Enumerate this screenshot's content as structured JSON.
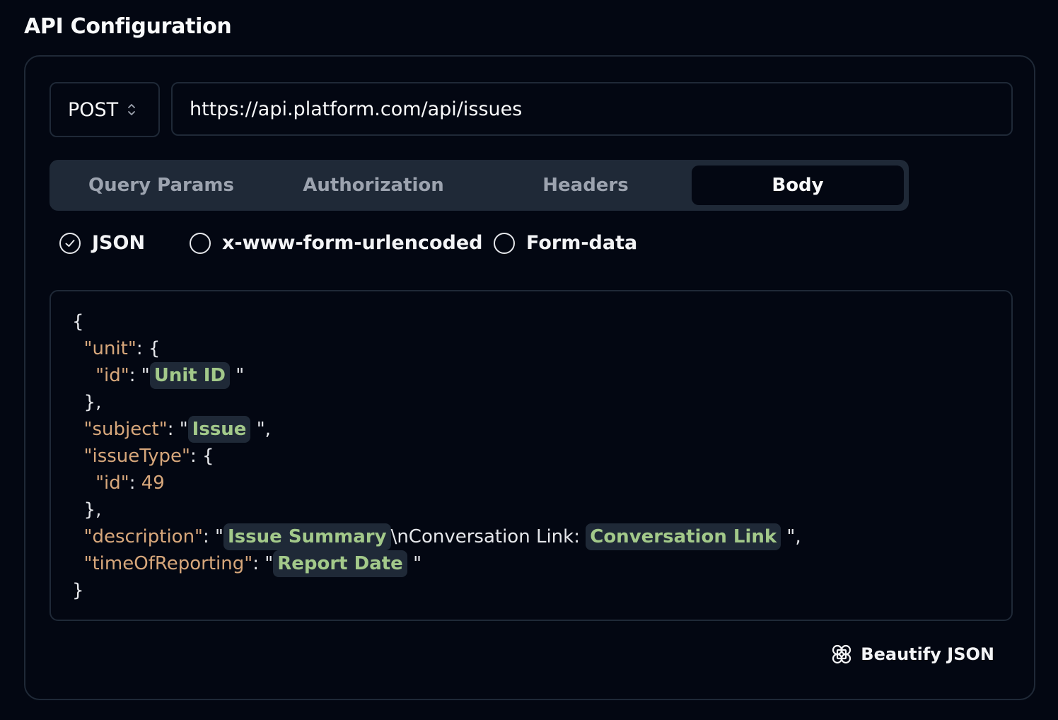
{
  "page": {
    "title": "API Configuration"
  },
  "request": {
    "method": "POST",
    "url": "https://api.platform.com/api/issues"
  },
  "tabs": [
    {
      "label": "Query Params",
      "active": false
    },
    {
      "label": "Authorization",
      "active": false
    },
    {
      "label": "Headers",
      "active": false
    },
    {
      "label": "Body",
      "active": true
    }
  ],
  "body_types": [
    {
      "label": "JSON",
      "selected": true
    },
    {
      "label": "x-www-form-urlencoded",
      "selected": false
    },
    {
      "label": "Form-data",
      "selected": false
    }
  ],
  "editor": {
    "keys": {
      "unit": "\"unit\"",
      "id": "\"id\"",
      "subject": "\"subject\"",
      "issueType": "\"issueType\"",
      "description": "\"description\"",
      "timeOfReporting": "\"timeOfReporting\""
    },
    "values": {
      "issue_type_id": "49",
      "description_literal": "\\nConversation Link: "
    },
    "placeholders": {
      "unit_id": "Unit ID",
      "subject": "Issue",
      "issue_summary": "Issue Summary",
      "conversation_link": "Conversation Link",
      "report_date": "Report Date"
    }
  },
  "actions": {
    "beautify_label": "Beautify JSON"
  },
  "icons": {
    "method_chevron": "chevron-up-down-icon",
    "beautify": "clover-icon",
    "radio_checked": "check-circle-icon"
  },
  "colors": {
    "background": "#030712",
    "border": "#1f2937",
    "json_key": "#d7a77b",
    "placeholder_text": "#a3c98a",
    "placeholder_bg": "#1f2937"
  }
}
